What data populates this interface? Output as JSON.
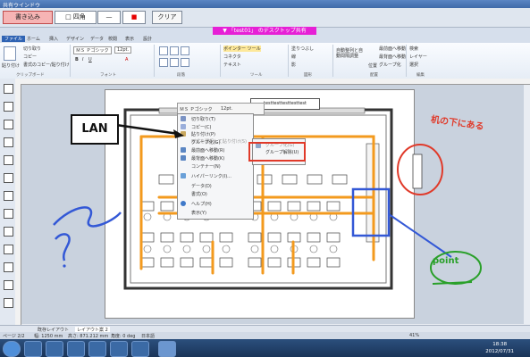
{
  "window": {
    "title": "共有ウインドウ"
  },
  "pen_toolbar": {
    "write_button": "書き込み",
    "shape_select": "□ 四角",
    "line_select": "—",
    "color_select": "■",
    "clear_button": "クリア"
  },
  "share_banner": "▼ 「test01」 のデスクトップ共有",
  "tabs": [
    "ファイル",
    "ホーム",
    "挿入",
    "デザイン",
    "データ",
    "校閲",
    "表示",
    "設計"
  ],
  "ribbon": {
    "clipboard": {
      "paste": "貼り付け",
      "cut": "切り取り",
      "copy": "コピー",
      "format_copy": "書式のコピー/貼り付け",
      "group": "クリップボード"
    },
    "font": {
      "name": "ＭＳ Ｐゴシック",
      "size": "12pt.",
      "group": "フォント"
    },
    "paragraph": {
      "group": "段落"
    },
    "tools": {
      "pointer": "ポインター ツール",
      "connector": "コネクタ",
      "text": "テキスト",
      "group": "ツール"
    },
    "shape": {
      "fill": "塗りつぶし",
      "line": "線",
      "shadow": "影",
      "group": "図形"
    },
    "arrange": {
      "auto_align": "自動整列と自動間隔調整",
      "position": "位置",
      "front": "最前面へ移動",
      "back": "最背面へ移動",
      "group_btn": "グループ化",
      "group": "配置"
    },
    "edit": {
      "find": "検索",
      "layer": "レイヤー",
      "select": "選択",
      "group": "編集"
    }
  },
  "context_menu": {
    "mini": {
      "font": "ＭＳ Ｐゴシック",
      "size": "12pt."
    },
    "items": [
      "切り取り(T)",
      "コピー(C)",
      "貼り付け(P)",
      "形式を選択して貼り付け(S)",
      "グループ化(G)",
      "最前面へ移動(R)",
      "最背面へ移動(K)",
      "コンテナー(N)",
      "ハイパーリンク(I)...",
      "データ(D)",
      "書式(O)",
      "ヘルプ(H)",
      "表示(Y)"
    ]
  },
  "submenu": {
    "items": [
      "グループ解除(U)",
      "グループ化(G)"
    ]
  },
  "page": {
    "textbox": "testtesttesttesttest"
  },
  "annotations": {
    "lan": "LAN",
    "under_desk": "机の下にある",
    "point": "point",
    "question": "?"
  },
  "sheets": {
    "tab1": "既存レイアウト",
    "tab2": "レイアウト案 2"
  },
  "status": {
    "page": "ページ 2/2",
    "width": "幅: 1250 mm",
    "height": "高さ: 871.212 mm",
    "angle": "角度: 0 deg",
    "lang": "日本語",
    "zoom": "41%"
  },
  "clock": {
    "time": "18:38",
    "date": "2012/07/31"
  },
  "colors": {
    "pen_red": "#e60000",
    "banner": "#e620d6",
    "orange_path": "#f39a1e",
    "blue_mark": "#3358d6",
    "green_mark": "#2aa02a"
  }
}
